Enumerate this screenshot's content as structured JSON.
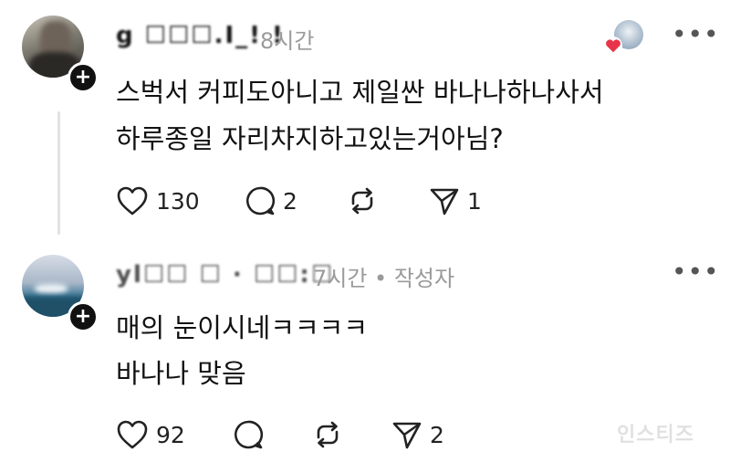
{
  "posts": [
    {
      "username": "g ☐☐☐.I_! !",
      "time": "8시간",
      "author_tag": "",
      "lines": [
        "스벅서 커피도아니고 제일싼 바나나하나사서",
        "하루종일 자리차지하고있는거아님?"
      ],
      "likes": "130",
      "comments": "2",
      "reposts": "",
      "shares": "1"
    },
    {
      "username": "yl☐☐ ☐ · ☐☐:☐",
      "time": "7시간 • 작성자",
      "lines": [
        "매의 눈이시네ㅋㅋㅋㅋ",
        "바나나 맞음"
      ],
      "likes": "92",
      "comments": "",
      "reposts": "",
      "shares": "2"
    }
  ],
  "watermark": "인스티즈",
  "colors": {
    "text": "#111111",
    "meta": "#9a9a9a",
    "heart": "#e8344a"
  }
}
